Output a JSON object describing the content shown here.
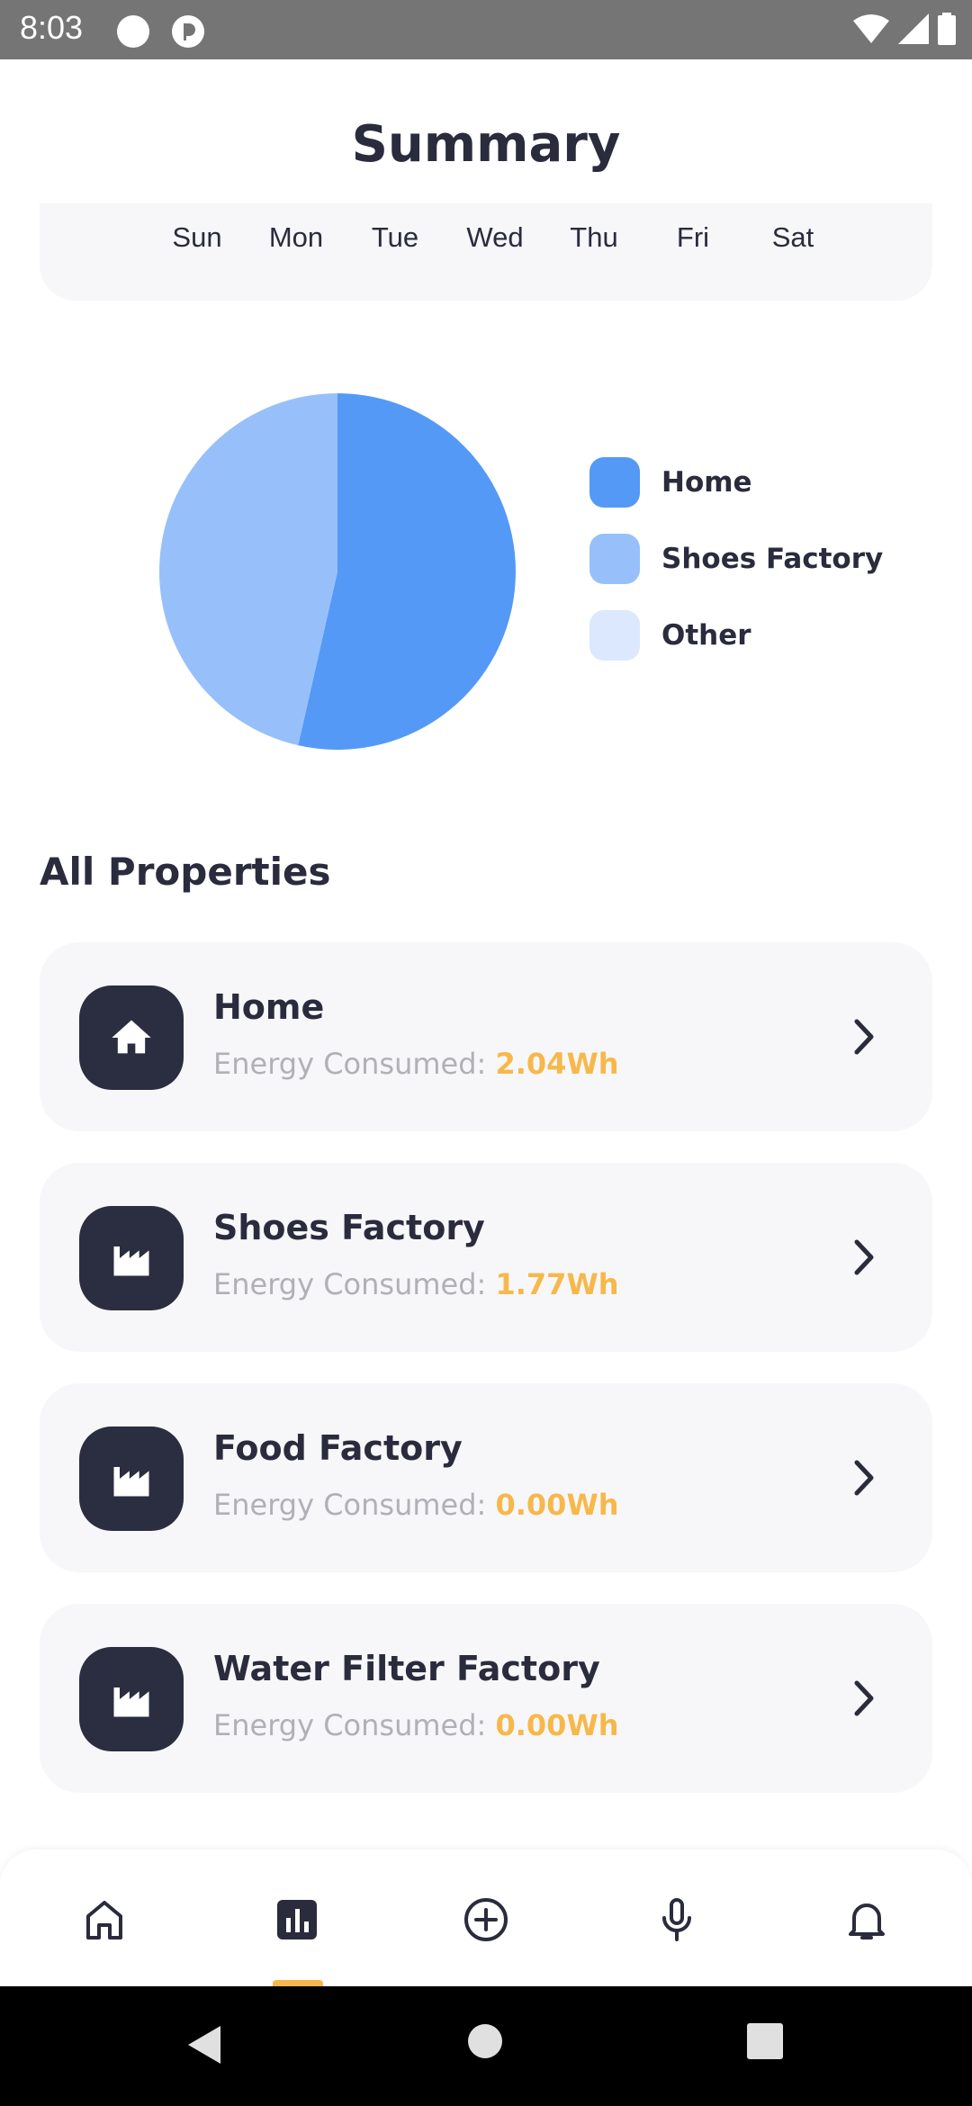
{
  "status_bar": {
    "time": "8:03"
  },
  "header": {
    "title": "Summary"
  },
  "days": [
    "Sun",
    "Mon",
    "Tue",
    "Wed",
    "Thu",
    "Fri",
    "Sat"
  ],
  "chart_data": {
    "type": "pie",
    "labels": [
      "Home",
      "Shoes Factory",
      "Other"
    ],
    "values": [
      2.04,
      1.77,
      0
    ],
    "colors": [
      "#5599f7",
      "#97c0fb",
      "#dbe8fd"
    ]
  },
  "legend": [
    {
      "label": "Home",
      "color": "#5599f7"
    },
    {
      "label": "Shoes Factory",
      "color": "#97c0fb"
    },
    {
      "label": "Other",
      "color": "#dbe8fd"
    }
  ],
  "properties_section": {
    "title": "All Properties"
  },
  "properties": [
    {
      "name": "Home",
      "energy_label": "Energy Consumed: ",
      "energy_value": "2.04Wh",
      "icon": "home-icon"
    },
    {
      "name": "Shoes Factory",
      "energy_label": "Energy Consumed: ",
      "energy_value": "1.77Wh",
      "icon": "factory-icon"
    },
    {
      "name": "Food Factory",
      "energy_label": "Energy Consumed: ",
      "energy_value": "0.00Wh",
      "icon": "factory-icon"
    },
    {
      "name": "Water Filter Factory",
      "energy_label": "Energy Consumed: ",
      "energy_value": "0.00Wh",
      "icon": "factory-icon"
    }
  ],
  "bottom_nav": {
    "items": [
      "home-icon",
      "stats-icon",
      "add-icon",
      "mic-icon",
      "bell-icon"
    ],
    "active": "stats-icon",
    "accent": "#f7b84b"
  },
  "colors": {
    "dark": "#2a2b3d",
    "card": "#f7f7f9",
    "accent": "#f7b84b"
  }
}
